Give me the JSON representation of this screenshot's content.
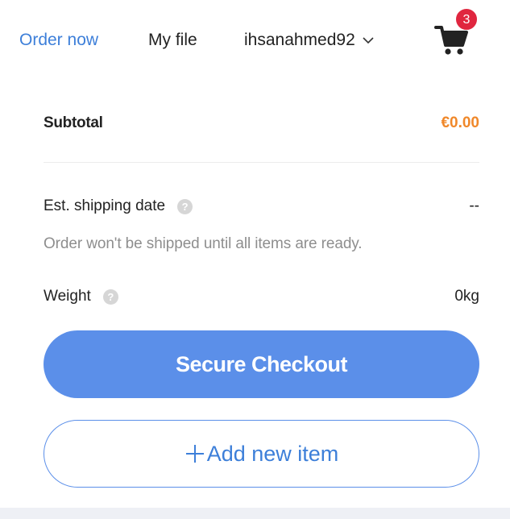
{
  "nav": {
    "order_now": "Order now",
    "my_file": "My file",
    "username": "ihsanahmed92",
    "cart_count": "3"
  },
  "summary": {
    "subtotal_label": "Subtotal",
    "subtotal_value": "€0.00",
    "shipping_label": "Est. shipping date",
    "shipping_value": "--",
    "shipping_note": "Order won't be shipped until all items are ready.",
    "weight_label": "Weight",
    "weight_value": "0kg",
    "help_glyph": "?"
  },
  "actions": {
    "checkout_label": "Secure Checkout",
    "add_item_label": "Add new item"
  },
  "colors": {
    "accent": "#5b8fe9",
    "link": "#3d7fd9",
    "price": "#f0882a",
    "badge": "#e0263f"
  },
  "icons": {
    "cart": "cart-icon",
    "chevron": "chevron-down-icon",
    "help": "help-icon",
    "plus": "plus-icon"
  }
}
